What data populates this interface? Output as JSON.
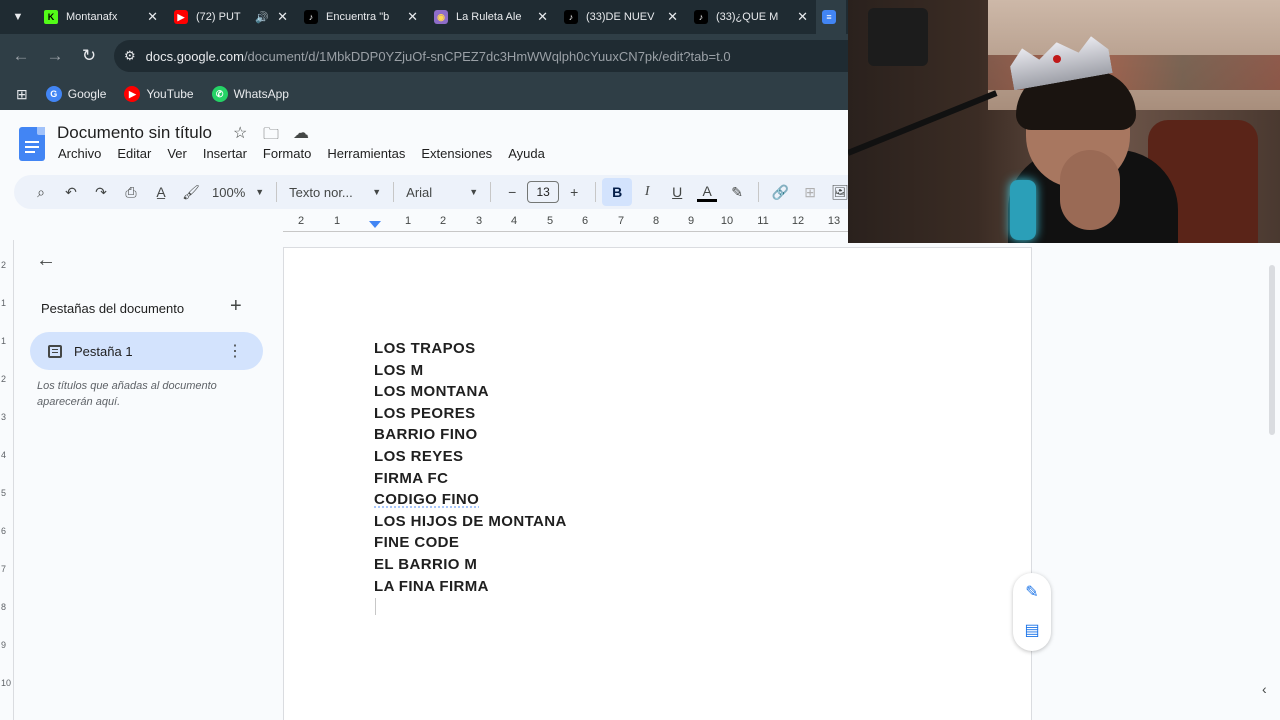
{
  "browser": {
    "tabs": [
      {
        "title": "Montanafx",
        "favicon": "K",
        "favicon_bg": "#53fc18",
        "favicon_fg": "#000000",
        "audio": false
      },
      {
        "title": "(72) PUT",
        "favicon": "▶",
        "favicon_bg": "#ff0000",
        "favicon_fg": "#ffffff",
        "audio": true
      },
      {
        "title": "Encuentra \"b",
        "favicon": "♪",
        "favicon_bg": "#000000",
        "favicon_fg": "#ffffff",
        "audio": false
      },
      {
        "title": "La Ruleta Ale",
        "favicon": "◉",
        "favicon_bg": "#8e6cc8",
        "favicon_fg": "#ffd54f",
        "audio": false
      },
      {
        "title": "(33)DE NUEV",
        "favicon": "♪",
        "favicon_bg": "#000000",
        "favicon_fg": "#ffffff",
        "audio": false
      },
      {
        "title": "(33)¿QUE M",
        "favicon": "♪",
        "favicon_bg": "#000000",
        "favicon_fg": "#ffffff",
        "audio": false
      }
    ],
    "url_host": "docs.google.com",
    "url_path": "/document/d/1MbkDDP0YZjuOf-snCPEZ7dc3HmWWqlph0cYuuxCN7pk/edit?tab=t.0",
    "bookmarks": [
      {
        "label": "Google",
        "icon": "G",
        "color": "#4285f4"
      },
      {
        "label": "YouTube",
        "icon": "▶",
        "color": "#ff0000"
      },
      {
        "label": "WhatsApp",
        "icon": "✆",
        "color": "#25d366"
      }
    ]
  },
  "docs": {
    "title": "Documento sin título",
    "menu": [
      "Archivo",
      "Editar",
      "Ver",
      "Insertar",
      "Formato",
      "Herramientas",
      "Extensiones",
      "Ayuda"
    ],
    "toolbar": {
      "zoom": "100%",
      "style": "Texto nor...",
      "font": "Arial",
      "font_size": "13",
      "bold": "B",
      "italic": "I",
      "underline": "U",
      "text_color": "A"
    },
    "ruler_numbers": [
      "2",
      "1",
      "1",
      "2",
      "3",
      "4",
      "5",
      "6",
      "7",
      "8",
      "9",
      "10",
      "11",
      "12",
      "13"
    ],
    "vruler_numbers": [
      "2",
      "1",
      "1",
      "2",
      "3",
      "4",
      "5",
      "6",
      "7",
      "8",
      "9",
      "10"
    ],
    "sidebar": {
      "heading": "Pestañas del documento",
      "tab_label": "Pestaña 1",
      "hint": "Los títulos que añadas al documento aparecerán aquí."
    },
    "content_lines": [
      "LOS TRAPOS",
      "LOS M",
      "LOS MONTANA",
      "LOS PEORES",
      "BARRIO FINO",
      "LOS REYES",
      "FIRMA FC",
      "CODIGO FINO",
      "LOS HIJOS DE MONTANA",
      "FINE CODE",
      "EL BARRIO M",
      "LA FINA FIRMA"
    ],
    "spellcheck_line": "CODIGO FINO"
  },
  "colors": {
    "accent": "#1a73e8",
    "chrome_dark": "#1f2b32",
    "selected_chip": "#d3e3fd"
  }
}
